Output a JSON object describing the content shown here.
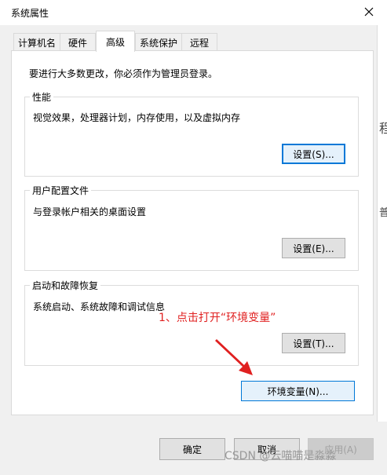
{
  "window": {
    "title": "系统属性",
    "close_icon": "close-icon"
  },
  "tabs": [
    {
      "label": "计算机名"
    },
    {
      "label": "硬件"
    },
    {
      "label": "高级",
      "active": true
    },
    {
      "label": "系统保护"
    },
    {
      "label": "远程"
    }
  ],
  "notice": "要进行大多数更改，你必须作为管理员登录。",
  "performance": {
    "title": "性能",
    "desc": "视觉效果，处理器计划，内存使用，以及虚拟内存",
    "button": "设置(S)..."
  },
  "profile": {
    "title": "用户配置文件",
    "desc": "与登录帐户相关的桌面设置",
    "button": "设置(E)..."
  },
  "startup": {
    "title": "启动和故障恢复",
    "desc": "系统启动、系统故障和调试信息",
    "button": "设置(T)..."
  },
  "env_button": "环境变量(N)...",
  "footer": {
    "ok": "确定",
    "cancel": "取消",
    "apply": "应用(A)"
  },
  "annotation": {
    "text": "1、点击打开“环境变量”",
    "color": "#e02020"
  },
  "watermark": "CSDN @云喵喵是淼淼",
  "background_glyphs": [
    "程",
    "普"
  ]
}
